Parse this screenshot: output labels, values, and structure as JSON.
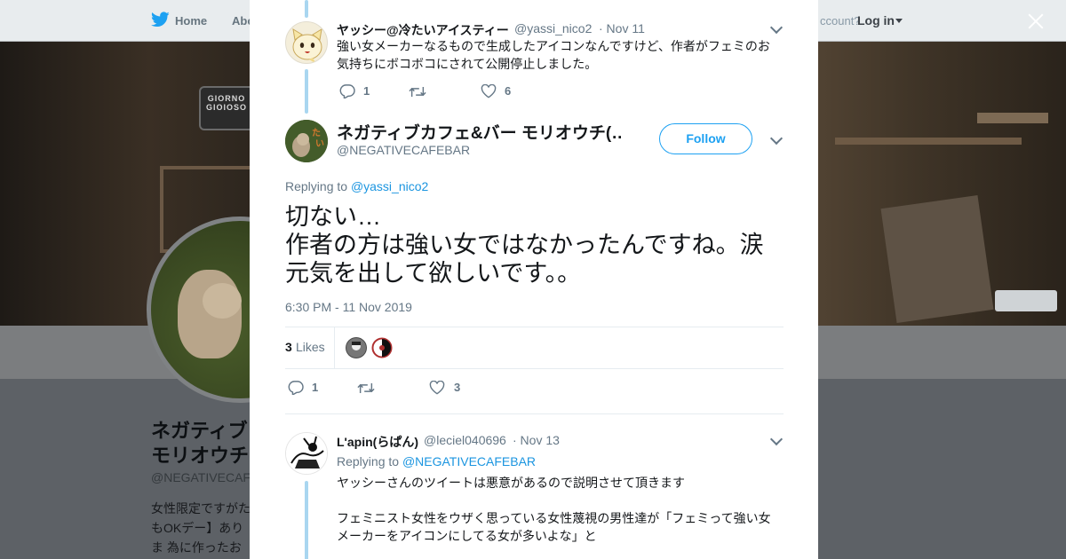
{
  "nav": {
    "home": "Home",
    "about": "Abo",
    "account": "ccount?",
    "login": "Log in"
  },
  "header_photo": {
    "sign_text": "GIORNO GIOIOSO"
  },
  "profile": {
    "name": "ネガティブカフェ&バー モリオウチ",
    "name_line1": "ネガティブ",
    "name_line2": "モリオウチ",
    "handle": "@NEGATIVECAFE",
    "bio": "女性限定ですがた もOKデー】ありま 為に作ったお店で で来て下さい。と"
  },
  "reply1": {
    "name": "ヤッシー@冷たいアイスティー",
    "handle": "@yassi_nico2",
    "date": "· Nov 11",
    "text": "強い女メーカーなるもので生成したアイコンなんですけど、作者がフェミのお気持ちにボコボコにされて公開停止しました。",
    "replies": "1",
    "retweets": "",
    "likes": "6"
  },
  "main_tweet": {
    "name": "ネガティブカフェ&バー モリオウチ(…",
    "handle": "@NEGATIVECAFEBAR",
    "follow_label": "Follow",
    "replying_prefix": "Replying to",
    "replying_to": "@yassi_nico2",
    "text_line1": "切ない…",
    "text_line2": "作者の方は強い女ではなかったんですね。涙",
    "text_line3": "元気を出して欲しいです。。",
    "timestamp": "6:30 PM - 11 Nov 2019",
    "likes_count": "3",
    "likes_label": "Likes",
    "replies": "1",
    "retweets": "",
    "likes": "3"
  },
  "reply2": {
    "name": "L'apin(らぱん)",
    "handle": "@leciel040696",
    "date": "· Nov 13",
    "replying_prefix": "Replying to",
    "replying_to": "@NEGATIVECAFEBAR",
    "text_line1": "ヤッシーさんのツイートは悪意があるので説明させて頂きます",
    "text_line2": "フェミニスト女性をウザく思っている女性蔑視の男性達が「フェミって強い女",
    "text_line3": "メーカーをアイコンにしてる女が多いよな」と"
  },
  "colors": {
    "link": "#1b95e0",
    "follow": "#1da1f2",
    "thread_line": "#a9d6f0",
    "muted": "#657786"
  },
  "icons": [
    "twitter-bird-icon",
    "close-icon",
    "reply-icon",
    "retweet-icon",
    "like-icon",
    "chevron-down-icon"
  ]
}
